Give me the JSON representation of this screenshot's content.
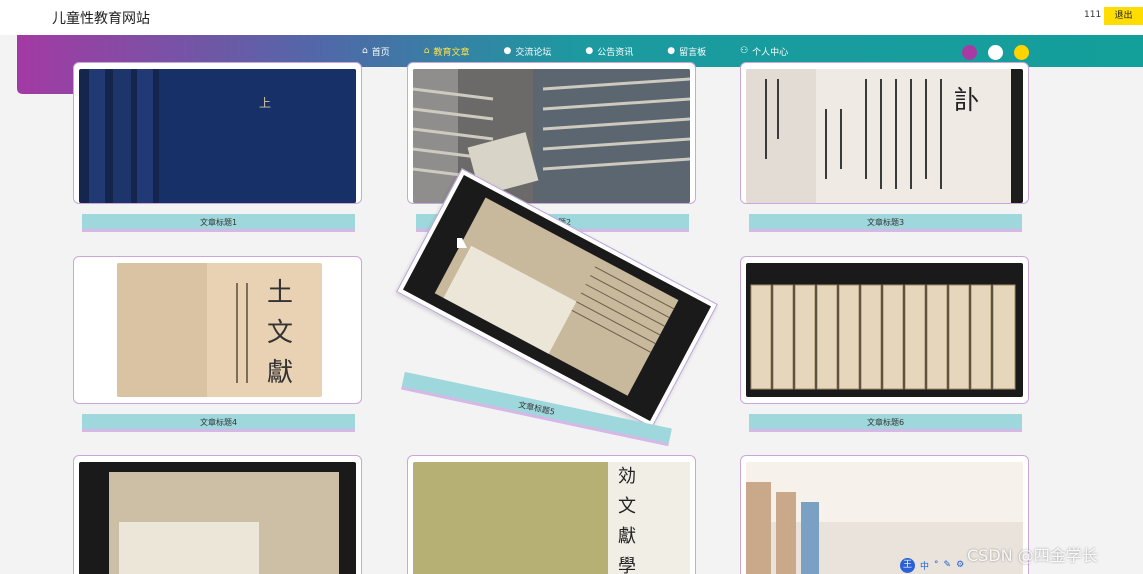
{
  "header": {
    "site_title": "儿童性教育网站",
    "user": "111",
    "logout": "退出"
  },
  "nav": {
    "items": [
      {
        "label": "首页",
        "icon": "home-icon",
        "active": false
      },
      {
        "label": "教育文章",
        "icon": "house-icon",
        "active": true
      },
      {
        "label": "交流论坛",
        "icon": "dot-icon",
        "active": false
      },
      {
        "label": "公告资讯",
        "icon": "dot-icon",
        "active": false
      },
      {
        "label": "留言板",
        "icon": "dot-icon",
        "active": false
      },
      {
        "label": "个人中心",
        "icon": "user-icon",
        "active": false
      }
    ],
    "theme_colors": [
      "#a83aa3",
      "#ffffff",
      "#ffd400"
    ]
  },
  "articles": [
    {
      "title": "文章标题1",
      "image": "blue-book-cover"
    },
    {
      "title": "文章标题2",
      "image": "bookshelf-gray-books"
    },
    {
      "title": "文章标题3",
      "image": "ancient-text-page"
    },
    {
      "title": "文章标题4",
      "image": "ancient-document-cover"
    },
    {
      "title": "文章标题5",
      "image": "open-ancient-book"
    },
    {
      "title": "文章标题6",
      "image": "row-of-bound-books"
    },
    {
      "title": "",
      "image": "open-ancient-book-2"
    },
    {
      "title": "",
      "image": "literature-book-cover"
    },
    {
      "title": "",
      "image": "library-bookshelf"
    }
  ],
  "overlay": {
    "watermark": "CSDN @四金学长",
    "toolbar": [
      "中",
      "°",
      "✎",
      "⚙"
    ]
  },
  "colors": {
    "nav_left": "#a83aa3",
    "nav_right": "#1b9d9c",
    "accent_yellow": "#ffdd00",
    "title_bar": "#9fd8dc"
  }
}
